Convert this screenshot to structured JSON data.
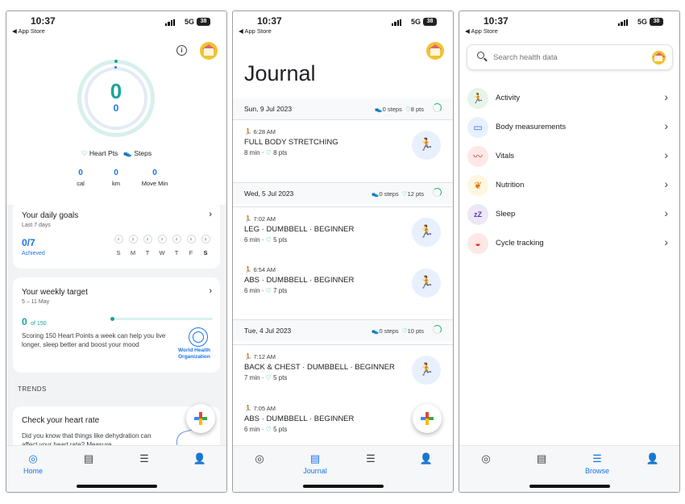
{
  "status": {
    "time": "10:37",
    "back": "◀ App Store",
    "network": "5G",
    "battery": "38"
  },
  "home": {
    "score_main": "0",
    "score_sub": "0",
    "heart_pts_label": "Heart Pts",
    "steps_label": "Steps",
    "stats": [
      {
        "value": "0",
        "label": "cal"
      },
      {
        "value": "0",
        "label": "km"
      },
      {
        "value": "0",
        "label": "Move Min"
      }
    ],
    "daily_goals": {
      "title": "Your daily goals",
      "subtitle": "Last 7 days",
      "achieved_value": "0/7",
      "achieved_label": "Achieved",
      "days": [
        "S",
        "M",
        "T",
        "W",
        "T",
        "F",
        "S"
      ],
      "day_marks": [
        "2",
        "2",
        "2",
        "2",
        "2",
        "2",
        "2"
      ]
    },
    "weekly_target": {
      "title": "Your weekly target",
      "dates": "5 – 11 May",
      "value": "0",
      "of_label": "of 150",
      "progress": 0,
      "description": "Scoring 150 Heart Points a week can help you live longer, sleep better and boost your mood",
      "who_label": "World Health Organization"
    },
    "trends_label": "TRENDS",
    "heart_rate": {
      "title": "Check your heart rate",
      "text": "Did you know that things like dehydration can affect your heart rate? Measure"
    }
  },
  "nav": {
    "home": "Home",
    "journal": "Journal",
    "browse": "Browse"
  },
  "journal": {
    "title": "Journal",
    "days": [
      {
        "date": "Sun, 9 Jul 2023",
        "steps": "0 steps",
        "pts": "8 pts",
        "activities": [
          {
            "time": "6:28 AM",
            "name": "FULL BODY STRETCHING",
            "duration": "8 min",
            "pts": "8 pts"
          }
        ]
      },
      {
        "date": "Wed, 5 Jul 2023",
        "steps": "0 steps",
        "pts": "12 pts",
        "activities": [
          {
            "time": "7:02 AM",
            "name": "LEG · DUMBBELL · BEGINNER",
            "duration": "6 min",
            "pts": "5 pts"
          },
          {
            "time": "6:54 AM",
            "name": "ABS · DUMBBELL · BEGINNER",
            "duration": "6 min",
            "pts": "7 pts"
          }
        ]
      },
      {
        "date": "Tue, 4 Jul 2023",
        "steps": "0 steps",
        "pts": "10 pts",
        "activities": [
          {
            "time": "7:12 AM",
            "name": "BACK & CHEST · DUMBBELL · BEGINNER",
            "duration": "7 min",
            "pts": "5 pts"
          },
          {
            "time": "7:05 AM",
            "name": "ABS · DUMBBELL · BEGINNER",
            "duration": "6 min",
            "pts": "5 pts"
          }
        ]
      }
    ]
  },
  "browse": {
    "search_placeholder": "Search health data",
    "categories": [
      {
        "label": "Activity",
        "icon": "activity-icon",
        "color": "#1e8e3e",
        "bg": "#e6f4ea"
      },
      {
        "label": "Body measurements",
        "icon": "ruler-icon",
        "color": "#1a73e8",
        "bg": "#e8f0fe"
      },
      {
        "label": "Vitals",
        "icon": "heartbeat-icon",
        "color": "#d93025",
        "bg": "#fce8e6"
      },
      {
        "label": "Nutrition",
        "icon": "apple-icon",
        "color": "#e37400",
        "bg": "#fef7e0"
      },
      {
        "label": "Sleep",
        "icon": "sleep-icon",
        "color": "#5e35b1",
        "bg": "#ede7f6"
      },
      {
        "label": "Cycle tracking",
        "icon": "cycle-icon",
        "color": "#d93025",
        "bg": "#fce8e6"
      }
    ]
  }
}
